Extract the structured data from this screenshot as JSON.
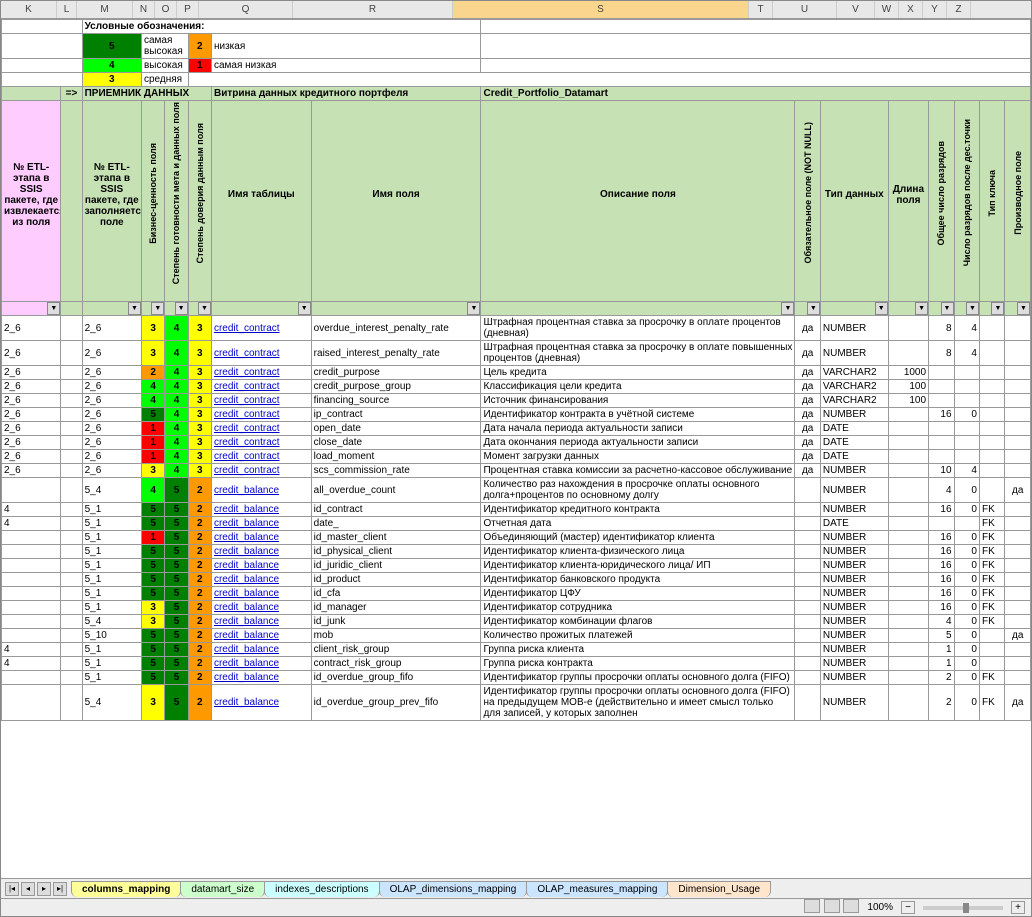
{
  "col_letters": [
    "K",
    "L",
    "M",
    "N",
    "O",
    "P",
    "Q",
    "R",
    "S",
    "T",
    "U",
    "V",
    "W",
    "X",
    "Y",
    "Z"
  ],
  "selected_col_index": 8,
  "legend": {
    "title": "Условные обозначения:",
    "items": [
      {
        "v": "5",
        "cls": "g5",
        "t": "самая высокая"
      },
      {
        "v": "4",
        "cls": "g4",
        "t": "высокая"
      },
      {
        "v": "3",
        "cls": "g3",
        "t": "средняя"
      },
      {
        "v": "2",
        "cls": "g2",
        "t": "низкая"
      },
      {
        "v": "1",
        "cls": "g1",
        "t": "самая низкая"
      }
    ]
  },
  "receiver": {
    "arrow": "=>",
    "label": "ПРИЕМНИК ДАННЫХ",
    "desc": "Витрина данных кредитного портфеля",
    "code": "Credit_Portfolio_Datamart"
  },
  "headers": {
    "k": "№ ETL-этапа в SSIS пакете, где извлекается из поля",
    "m": "№ ETL-этапа в SSIS пакете, где заполняется поле",
    "n": "Бизнес-ценность поля",
    "o": "Степень готовности мета и данных поля",
    "p": "Степень доверия данным поля",
    "q": "Имя таблицы",
    "r": "Имя поля",
    "s": "Описание поля",
    "t": "Обязательное поле (NOT NULL)",
    "u": "Тип данных",
    "v": "Длина поля",
    "w": "Общее число разрядов",
    "x": "Число разрядов после дес.точки",
    "y": "Тип ключа",
    "z": "Производное поле"
  },
  "rows": [
    {
      "k": "2_6",
      "m": "2_6",
      "n": "3",
      "o": "4",
      "p": "3",
      "tbl": "credit_contract",
      "fld": "overdue_interest_penalty_rate",
      "desc": "Штрафная процентная ставка за просрочку в оплате процентов (дневная)",
      "req": "да",
      "typ": "NUMBER",
      "len": "",
      "tot": "8",
      "dec": "4",
      "key": "",
      "der": ""
    },
    {
      "k": "2_6",
      "m": "2_6",
      "n": "3",
      "o": "4",
      "p": "3",
      "tbl": "credit_contract",
      "fld": "raised_interest_penalty_rate",
      "desc": "Штрафная процентная ставка за просрочку в оплате повышенных процентов (дневная)",
      "req": "да",
      "typ": "NUMBER",
      "len": "",
      "tot": "8",
      "dec": "4",
      "key": "",
      "der": ""
    },
    {
      "k": "2_6",
      "m": "2_6",
      "n": "2",
      "o": "4",
      "p": "3",
      "tbl": "credit_contract",
      "fld": "credit_purpose",
      "desc": "Цель кредита",
      "req": "да",
      "typ": "VARCHAR2",
      "len": "1000",
      "tot": "",
      "dec": "",
      "key": "",
      "der": ""
    },
    {
      "k": "2_6",
      "m": "2_6",
      "n": "4",
      "o": "4",
      "p": "3",
      "tbl": "credit_contract",
      "fld": "credit_purpose_group",
      "desc": "Классификация цели кредита",
      "req": "да",
      "typ": "VARCHAR2",
      "len": "100",
      "tot": "",
      "dec": "",
      "key": "",
      "der": ""
    },
    {
      "k": "2_6",
      "m": "2_6",
      "n": "4",
      "o": "4",
      "p": "3",
      "tbl": "credit_contract",
      "fld": "financing_source",
      "desc": "Источник финансирования",
      "req": "да",
      "typ": "VARCHAR2",
      "len": "100",
      "tot": "",
      "dec": "",
      "key": "",
      "der": ""
    },
    {
      "k": "2_6",
      "m": "2_6",
      "n": "5",
      "o": "4",
      "p": "3",
      "tbl": "credit_contract",
      "fld": "ip_contract",
      "desc": "Идентификатор контракта в учётной системе",
      "req": "да",
      "typ": "NUMBER",
      "len": "",
      "tot": "16",
      "dec": "0",
      "key": "",
      "der": ""
    },
    {
      "k": "2_6",
      "m": "2_6",
      "n": "1",
      "o": "4",
      "p": "3",
      "tbl": "credit_contract",
      "fld": "open_date",
      "desc": "Дата начала периода актуальности записи",
      "req": "да",
      "typ": "DATE",
      "len": "",
      "tot": "",
      "dec": "",
      "key": "",
      "der": ""
    },
    {
      "k": "2_6",
      "m": "2_6",
      "n": "1",
      "o": "4",
      "p": "3",
      "tbl": "credit_contract",
      "fld": "close_date",
      "desc": "Дата окончания периода актуальности записи",
      "req": "да",
      "typ": "DATE",
      "len": "",
      "tot": "",
      "dec": "",
      "key": "",
      "der": ""
    },
    {
      "k": "2_6",
      "m": "2_6",
      "n": "1",
      "o": "4",
      "p": "3",
      "tbl": "credit_contract",
      "fld": "load_moment",
      "desc": "Момент загрузки данных",
      "req": "да",
      "typ": "DATE",
      "len": "",
      "tot": "",
      "dec": "",
      "key": "",
      "der": ""
    },
    {
      "k": "2_6",
      "m": "2_6",
      "n": "3",
      "o": "4",
      "p": "3",
      "tbl": "credit_contract",
      "fld": "scs_commission_rate",
      "desc": "Процентная ставка комиссии за расчетно-кассовое обслуживание",
      "req": "да",
      "typ": "NUMBER",
      "len": "",
      "tot": "10",
      "dec": "4",
      "key": "",
      "der": ""
    },
    {
      "k": "",
      "m": "5_4",
      "n": "4",
      "o": "5",
      "p": "2",
      "tbl": "credit_balance",
      "fld": "all_overdue_count",
      "desc": "Количество раз нахождения в просрочке оплаты основного долга+процентов по основному долгу",
      "req": "",
      "typ": "NUMBER",
      "len": "",
      "tot": "4",
      "dec": "0",
      "key": "",
      "der": "да"
    },
    {
      "k": "4",
      "m": "5_1",
      "n": "5",
      "o": "5",
      "p": "2",
      "tbl": "credit_balance",
      "fld": "id_contract",
      "desc": "Идентификатор кредитного контракта",
      "req": "",
      "typ": "NUMBER",
      "len": "",
      "tot": "16",
      "dec": "0",
      "key": "FK",
      "der": ""
    },
    {
      "k": "4",
      "m": "5_1",
      "n": "5",
      "o": "5",
      "p": "2",
      "tbl": "credit_balance",
      "fld": "date_",
      "desc": "Отчетная дата",
      "req": "",
      "typ": "DATE",
      "len": "",
      "tot": "",
      "dec": "",
      "key": "FK",
      "der": ""
    },
    {
      "k": "",
      "m": "5_1",
      "n": "1",
      "o": "5",
      "p": "2",
      "tbl": "credit_balance",
      "fld": "id_master_client",
      "desc": "Объединяющий (мастер) идентификатор клиента",
      "req": "",
      "typ": "NUMBER",
      "len": "",
      "tot": "16",
      "dec": "0",
      "key": "FK",
      "der": ""
    },
    {
      "k": "",
      "m": "5_1",
      "n": "5",
      "o": "5",
      "p": "2",
      "tbl": "credit_balance",
      "fld": "id_physical_client",
      "desc": "Идентификатор клиента-физического лица",
      "req": "",
      "typ": "NUMBER",
      "len": "",
      "tot": "16",
      "dec": "0",
      "key": "FK",
      "der": ""
    },
    {
      "k": "",
      "m": "5_1",
      "n": "5",
      "o": "5",
      "p": "2",
      "tbl": "credit_balance",
      "fld": "id_juridic_client",
      "desc": "Идентификатор клиента-юридического лица/ ИП",
      "req": "",
      "typ": "NUMBER",
      "len": "",
      "tot": "16",
      "dec": "0",
      "key": "FK",
      "der": ""
    },
    {
      "k": "",
      "m": "5_1",
      "n": "5",
      "o": "5",
      "p": "2",
      "tbl": "credit_balance",
      "fld": "id_product",
      "desc": "Идентификатор банковского продукта",
      "req": "",
      "typ": "NUMBER",
      "len": "",
      "tot": "16",
      "dec": "0",
      "key": "FK",
      "der": ""
    },
    {
      "k": "",
      "m": "5_1",
      "n": "5",
      "o": "5",
      "p": "2",
      "tbl": "credit_balance",
      "fld": "id_cfa",
      "desc": "Идентификатор ЦФУ",
      "req": "",
      "typ": "NUMBER",
      "len": "",
      "tot": "16",
      "dec": "0",
      "key": "FK",
      "der": ""
    },
    {
      "k": "",
      "m": "5_1",
      "n": "3",
      "o": "5",
      "p": "2",
      "tbl": "credit_balance",
      "fld": "id_manager",
      "desc": "Идентификатор сотрудника",
      "req": "",
      "typ": "NUMBER",
      "len": "",
      "tot": "16",
      "dec": "0",
      "key": "FK",
      "der": ""
    },
    {
      "k": "",
      "m": "5_4",
      "n": "3",
      "o": "5",
      "p": "2",
      "tbl": "credit_balance",
      "fld": "id_junk",
      "desc": "Идентификатор комбинации флагов",
      "req": "",
      "typ": "NUMBER",
      "len": "",
      "tot": "4",
      "dec": "0",
      "key": "FK",
      "der": ""
    },
    {
      "k": "",
      "m": "5_10",
      "n": "5",
      "o": "5",
      "p": "2",
      "tbl": "credit_balance",
      "fld": "mob",
      "desc": "Количество прожитых платежей",
      "req": "",
      "typ": "NUMBER",
      "len": "",
      "tot": "5",
      "dec": "0",
      "key": "",
      "der": "да"
    },
    {
      "k": "4",
      "m": "5_1",
      "n": "5",
      "o": "5",
      "p": "2",
      "tbl": "credit_balance",
      "fld": "client_risk_group",
      "desc": "Группа риска клиента",
      "req": "",
      "typ": "NUMBER",
      "len": "",
      "tot": "1",
      "dec": "0",
      "key": "",
      "der": ""
    },
    {
      "k": "4",
      "m": "5_1",
      "n": "5",
      "o": "5",
      "p": "2",
      "tbl": "credit_balance",
      "fld": "contract_risk_group",
      "desc": "Группа риска контракта",
      "req": "",
      "typ": "NUMBER",
      "len": "",
      "tot": "1",
      "dec": "0",
      "key": "",
      "der": ""
    },
    {
      "k": "",
      "m": "5_1",
      "n": "5",
      "o": "5",
      "p": "2",
      "tbl": "credit_balance",
      "fld": "id_overdue_group_fifo",
      "desc": "Идентификатор группы просрочки оплаты основного долга (FIFO)",
      "req": "",
      "typ": "NUMBER",
      "len": "",
      "tot": "2",
      "dec": "0",
      "key": "FK",
      "der": ""
    },
    {
      "k": "",
      "m": "5_4",
      "n": "3",
      "o": "5",
      "p": "2",
      "tbl": "credit_balance",
      "fld": "id_overdue_group_prev_fifo",
      "desc": "Идентификатор группы просрочки оплаты основного долга (FIFO) на предыдущем MOB-е (действительно и имеет смысл только для записей, у которых заполнен",
      "req": "",
      "typ": "NUMBER",
      "len": "",
      "tot": "2",
      "dec": "0",
      "key": "FK",
      "der": "да"
    }
  ],
  "tabs": [
    "columns_mapping",
    "datamart_size",
    "indexes_descriptions",
    "OLAP_dimensions_mapping",
    "OLAP_measures_mapping",
    "Dimension_Usage"
  ],
  "active_tab": 0,
  "status": {
    "zoom": "100%",
    "minus": "−",
    "plus": "+"
  }
}
